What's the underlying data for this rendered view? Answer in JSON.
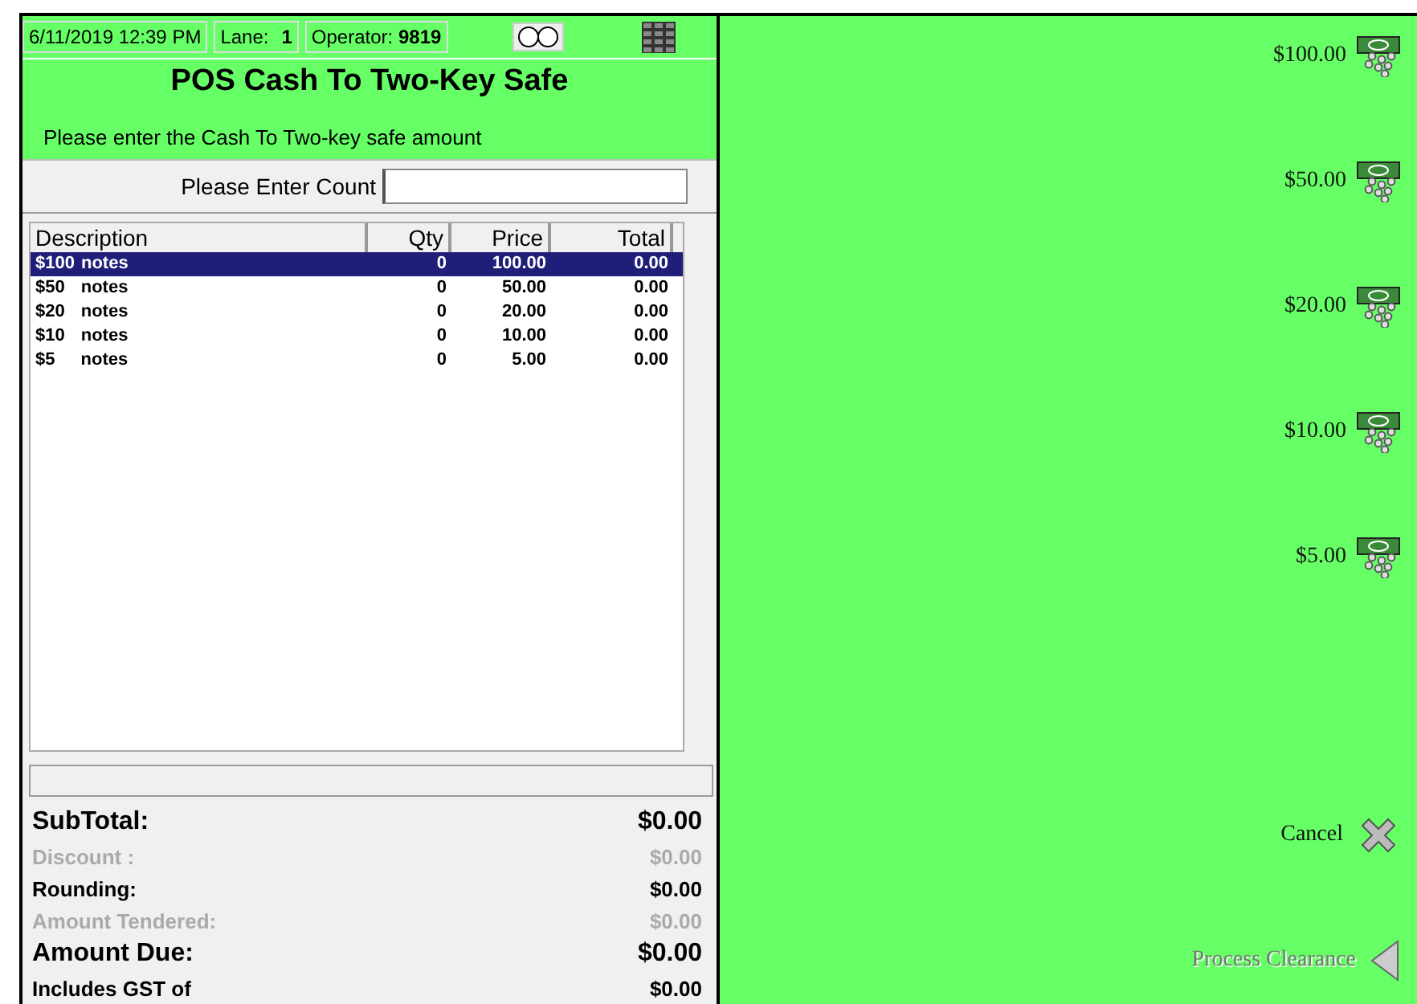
{
  "header": {
    "datetime": "6/11/2019 12:39 PM",
    "lane_label": "Lane:",
    "lane": "1",
    "operator_label": "Operator:",
    "operator": "9819"
  },
  "title": "POS Cash To Two-Key Safe",
  "instruction": "Please enter the Cash To Two-key safe amount",
  "count_field": {
    "label": "Please Enter Count"
  },
  "table": {
    "columns": [
      "Description",
      "Qty",
      "Price",
      "Total"
    ],
    "rows": [
      {
        "denomination": "$100",
        "unit": "notes",
        "qty": "0",
        "price": "100.00",
        "total": "0.00",
        "selected": true
      },
      {
        "denomination": "$50",
        "unit": "notes",
        "qty": "0",
        "price": "50.00",
        "total": "0.00",
        "selected": false
      },
      {
        "denomination": "$20",
        "unit": "notes",
        "qty": "0",
        "price": "20.00",
        "total": "0.00",
        "selected": false
      },
      {
        "denomination": "$10",
        "unit": "notes",
        "qty": "0",
        "price": "10.00",
        "total": "0.00",
        "selected": false
      },
      {
        "denomination": "$5",
        "unit": "notes",
        "qty": "0",
        "price": "5.00",
        "total": "0.00",
        "selected": false
      }
    ]
  },
  "totals": [
    {
      "label": "SubTotal:",
      "value": "$0.00",
      "kind": "large",
      "disabled": false
    },
    {
      "label": "Discount :",
      "value": "$0.00",
      "kind": "normal",
      "disabled": true
    },
    {
      "label": "Rounding:",
      "value": "$0.00",
      "kind": "normal",
      "disabled": false
    },
    {
      "label": "Amount Tendered:",
      "value": "$0.00",
      "kind": "normal",
      "disabled": true
    },
    {
      "label": "Amount Due:",
      "value": "$0.00",
      "kind": "large",
      "disabled": false
    },
    {
      "label": "Includes GST of",
      "value": "$0.00",
      "kind": "normal",
      "disabled": false
    }
  ],
  "denominations": [
    {
      "label": "$100.00"
    },
    {
      "label": "$50.00"
    },
    {
      "label": "$20.00"
    },
    {
      "label": "$10.00"
    },
    {
      "label": "$5.00"
    }
  ],
  "actions": [
    {
      "label": "Cancel",
      "kind": "cancel",
      "disabled": false
    },
    {
      "label": "Process Clearance",
      "kind": "process",
      "disabled": true
    }
  ]
}
